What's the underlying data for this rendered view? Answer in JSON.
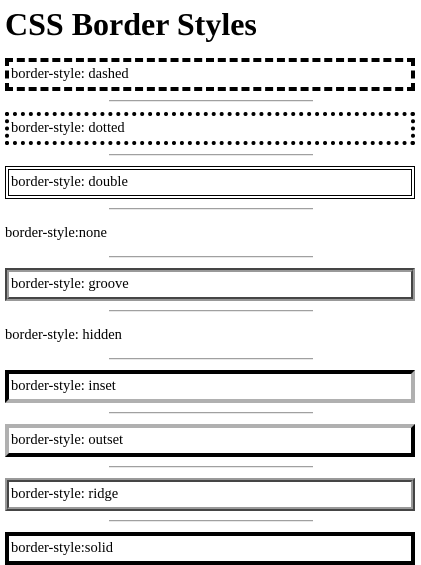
{
  "page": {
    "title": "CSS Border Styles"
  },
  "items": [
    {
      "label": "border-style: dashed",
      "style": "dashed"
    },
    {
      "label": "border-style: dotted",
      "style": "dotted"
    },
    {
      "label": "border-style: double",
      "style": "double"
    },
    {
      "label": "border-style:none",
      "style": "none"
    },
    {
      "label": "border-style: groove",
      "style": "groove"
    },
    {
      "label": "border-style: hidden",
      "style": "hidden"
    },
    {
      "label": "border-style: inset",
      "style": "inset"
    },
    {
      "label": "border-style: outset",
      "style": "outset"
    },
    {
      "label": "border-style: ridge",
      "style": "ridge"
    },
    {
      "label": "border-style:solid",
      "style": "solid"
    }
  ],
  "colors": {
    "text": "#000000",
    "separator": "#a0a0a0",
    "background": "#ffffff"
  }
}
